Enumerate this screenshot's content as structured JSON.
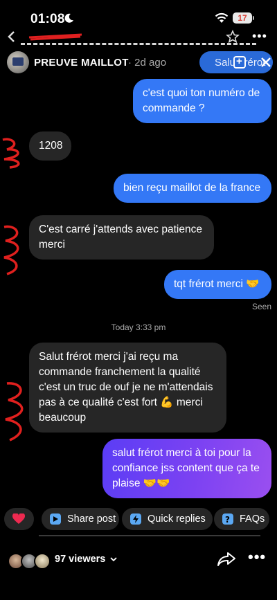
{
  "status_bar": {
    "time": "01:08",
    "battery": "17"
  },
  "header": {
    "account_name": "PREUVE MAILLOT",
    "time_ago": "· 2d ago",
    "reply_pill_text": "Salut frérot"
  },
  "messages": [
    {
      "direction": "outgoing",
      "text": "c'est quoi ton numéro de commande ?"
    },
    {
      "direction": "incoming",
      "text": "1208"
    },
    {
      "direction": "outgoing",
      "text": "bien reçu maillot de la france"
    },
    {
      "direction": "incoming",
      "text": "C'est carré j'attends avec patience merci"
    },
    {
      "direction": "outgoing",
      "text": "tqt frérot merci 🤝"
    },
    {
      "direction": "incoming",
      "text": "Salut frérot merci j'ai reçu ma commande franchement la qualité c'est un truc de ouf je ne m'attendais pas à ce qualité c'est fort 💪 merci beaucoup"
    },
    {
      "direction": "outgoing",
      "text": "salut frérot merci à toi pour la confiance jss content que ça te plaise 🤝🤝"
    }
  ],
  "seen_label": "Seen",
  "timestamp_divider": "Today 3:33 pm",
  "actions": {
    "like_icon": "heart-icon",
    "share_post": "Share post",
    "quick_replies": "Quick replies",
    "faqs": "FAQs"
  },
  "footer": {
    "viewers": "97 viewers"
  },
  "colors": {
    "outgoing_bubble": "#3478f6",
    "incoming_bubble": "#262626",
    "gradient_bubble": "#7c42f2",
    "heart": "#ee2a50",
    "chip_icon": "#5ba8f3"
  }
}
